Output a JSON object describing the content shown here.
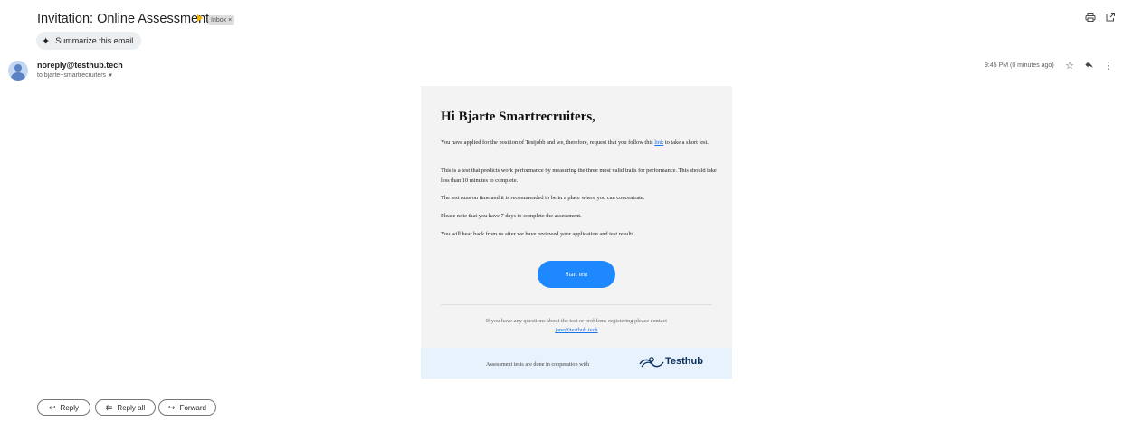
{
  "email": {
    "subject": "Invitation: Online Assessment",
    "label": "Inbox",
    "label_close": "×",
    "summarize_label": "Summarize this email",
    "sender": "noreply@testhub.tech",
    "to_line": "to bjarte+smartrecruiters",
    "time": "9:45 PM (0 minutes ago)"
  },
  "icons": {
    "importance": "importance-marker-icon",
    "print": "print-icon",
    "open_new": "open-in-new-window-icon",
    "sparkle": "sparkle-icon",
    "star": "star-icon",
    "reply": "reply-icon",
    "more": "more-vert-icon",
    "caret": "chevron-down-icon",
    "reply_all": "reply-all-icon",
    "forward": "forward-icon",
    "brand_logo": "testhub-logo-icon",
    "avatar": "default-avatar-icon"
  },
  "body": {
    "greeting": "Hi Bjarte Smartrecruiters,",
    "p1_before": "You have applied for the position of Testjobb and we, therefore, request that you follow this ",
    "p1_link": "link",
    "p1_after": " to take a short test.",
    "p2": "This is a test that predicts work performance by measuring the three most valid traits for performance. This should take less than 10 minutes to complete.",
    "p3": "The test runs on time and it is recommended to be in a place where you can concentrate.",
    "p4": "Please note that you have 7 days to complete the assessment.",
    "p5": "You will hear back from us after we have reviewed your application and test results.",
    "start_button": "Start test",
    "footer_text": "If you have any questions about the test or problems registering please contact ",
    "footer_email": "jane@testhub.tech",
    "coop_text": "Assessment tests are done in cooperation with",
    "brand_name": "Testhub"
  },
  "actions": {
    "reply": "Reply",
    "reply_all": "Reply all",
    "forward": "Forward"
  },
  "colors": {
    "accent": "#1e88ff",
    "link": "#1a73e8",
    "card_bg": "#f3f3f3",
    "coop_band": "#e8f2fc",
    "brand_navy": "#0b2e5e",
    "importance": "#f4b400"
  }
}
